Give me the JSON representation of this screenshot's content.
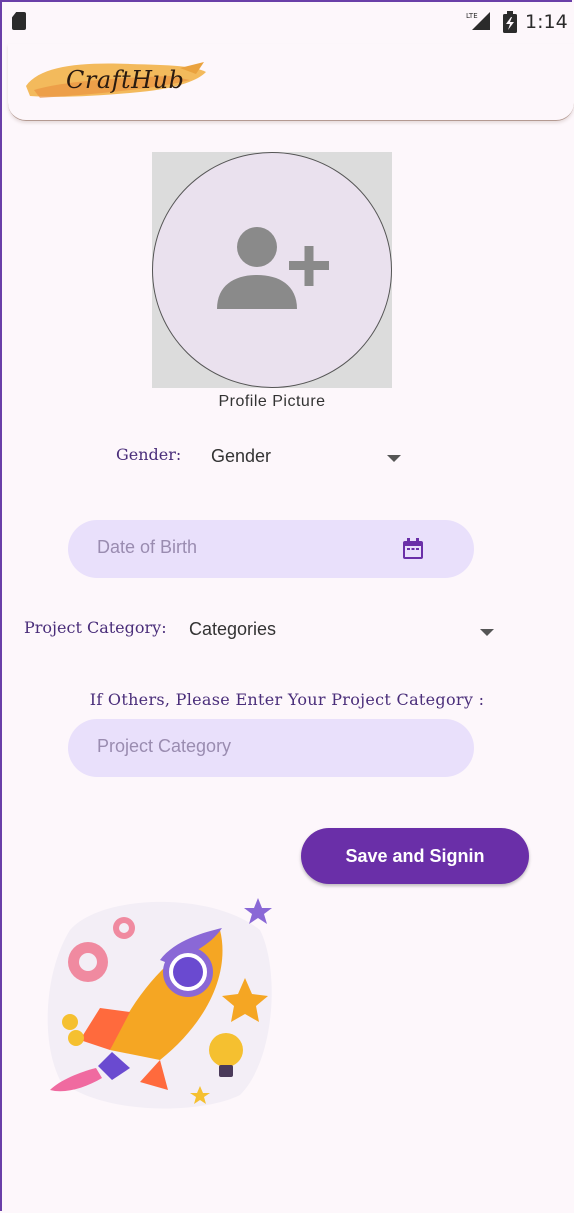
{
  "status_bar": {
    "time": "1:14",
    "network": "LTE"
  },
  "app_bar": {
    "logo_text": "CraftHub"
  },
  "profile": {
    "caption": "Profile Picture"
  },
  "gender": {
    "label": "Gender:",
    "selected": "Gender"
  },
  "dob": {
    "placeholder": "Date of Birth"
  },
  "category": {
    "label": "Project Category:",
    "selected": "Categories"
  },
  "others": {
    "prompt": "If Others, Please Enter Your Project Category :",
    "placeholder": "Project Category"
  },
  "actions": {
    "save_label": "Save and Signin"
  },
  "colors": {
    "accent": "#6a2fa8",
    "field_bg": "#e9e0fb",
    "page_bg": "#fdf7fb"
  }
}
